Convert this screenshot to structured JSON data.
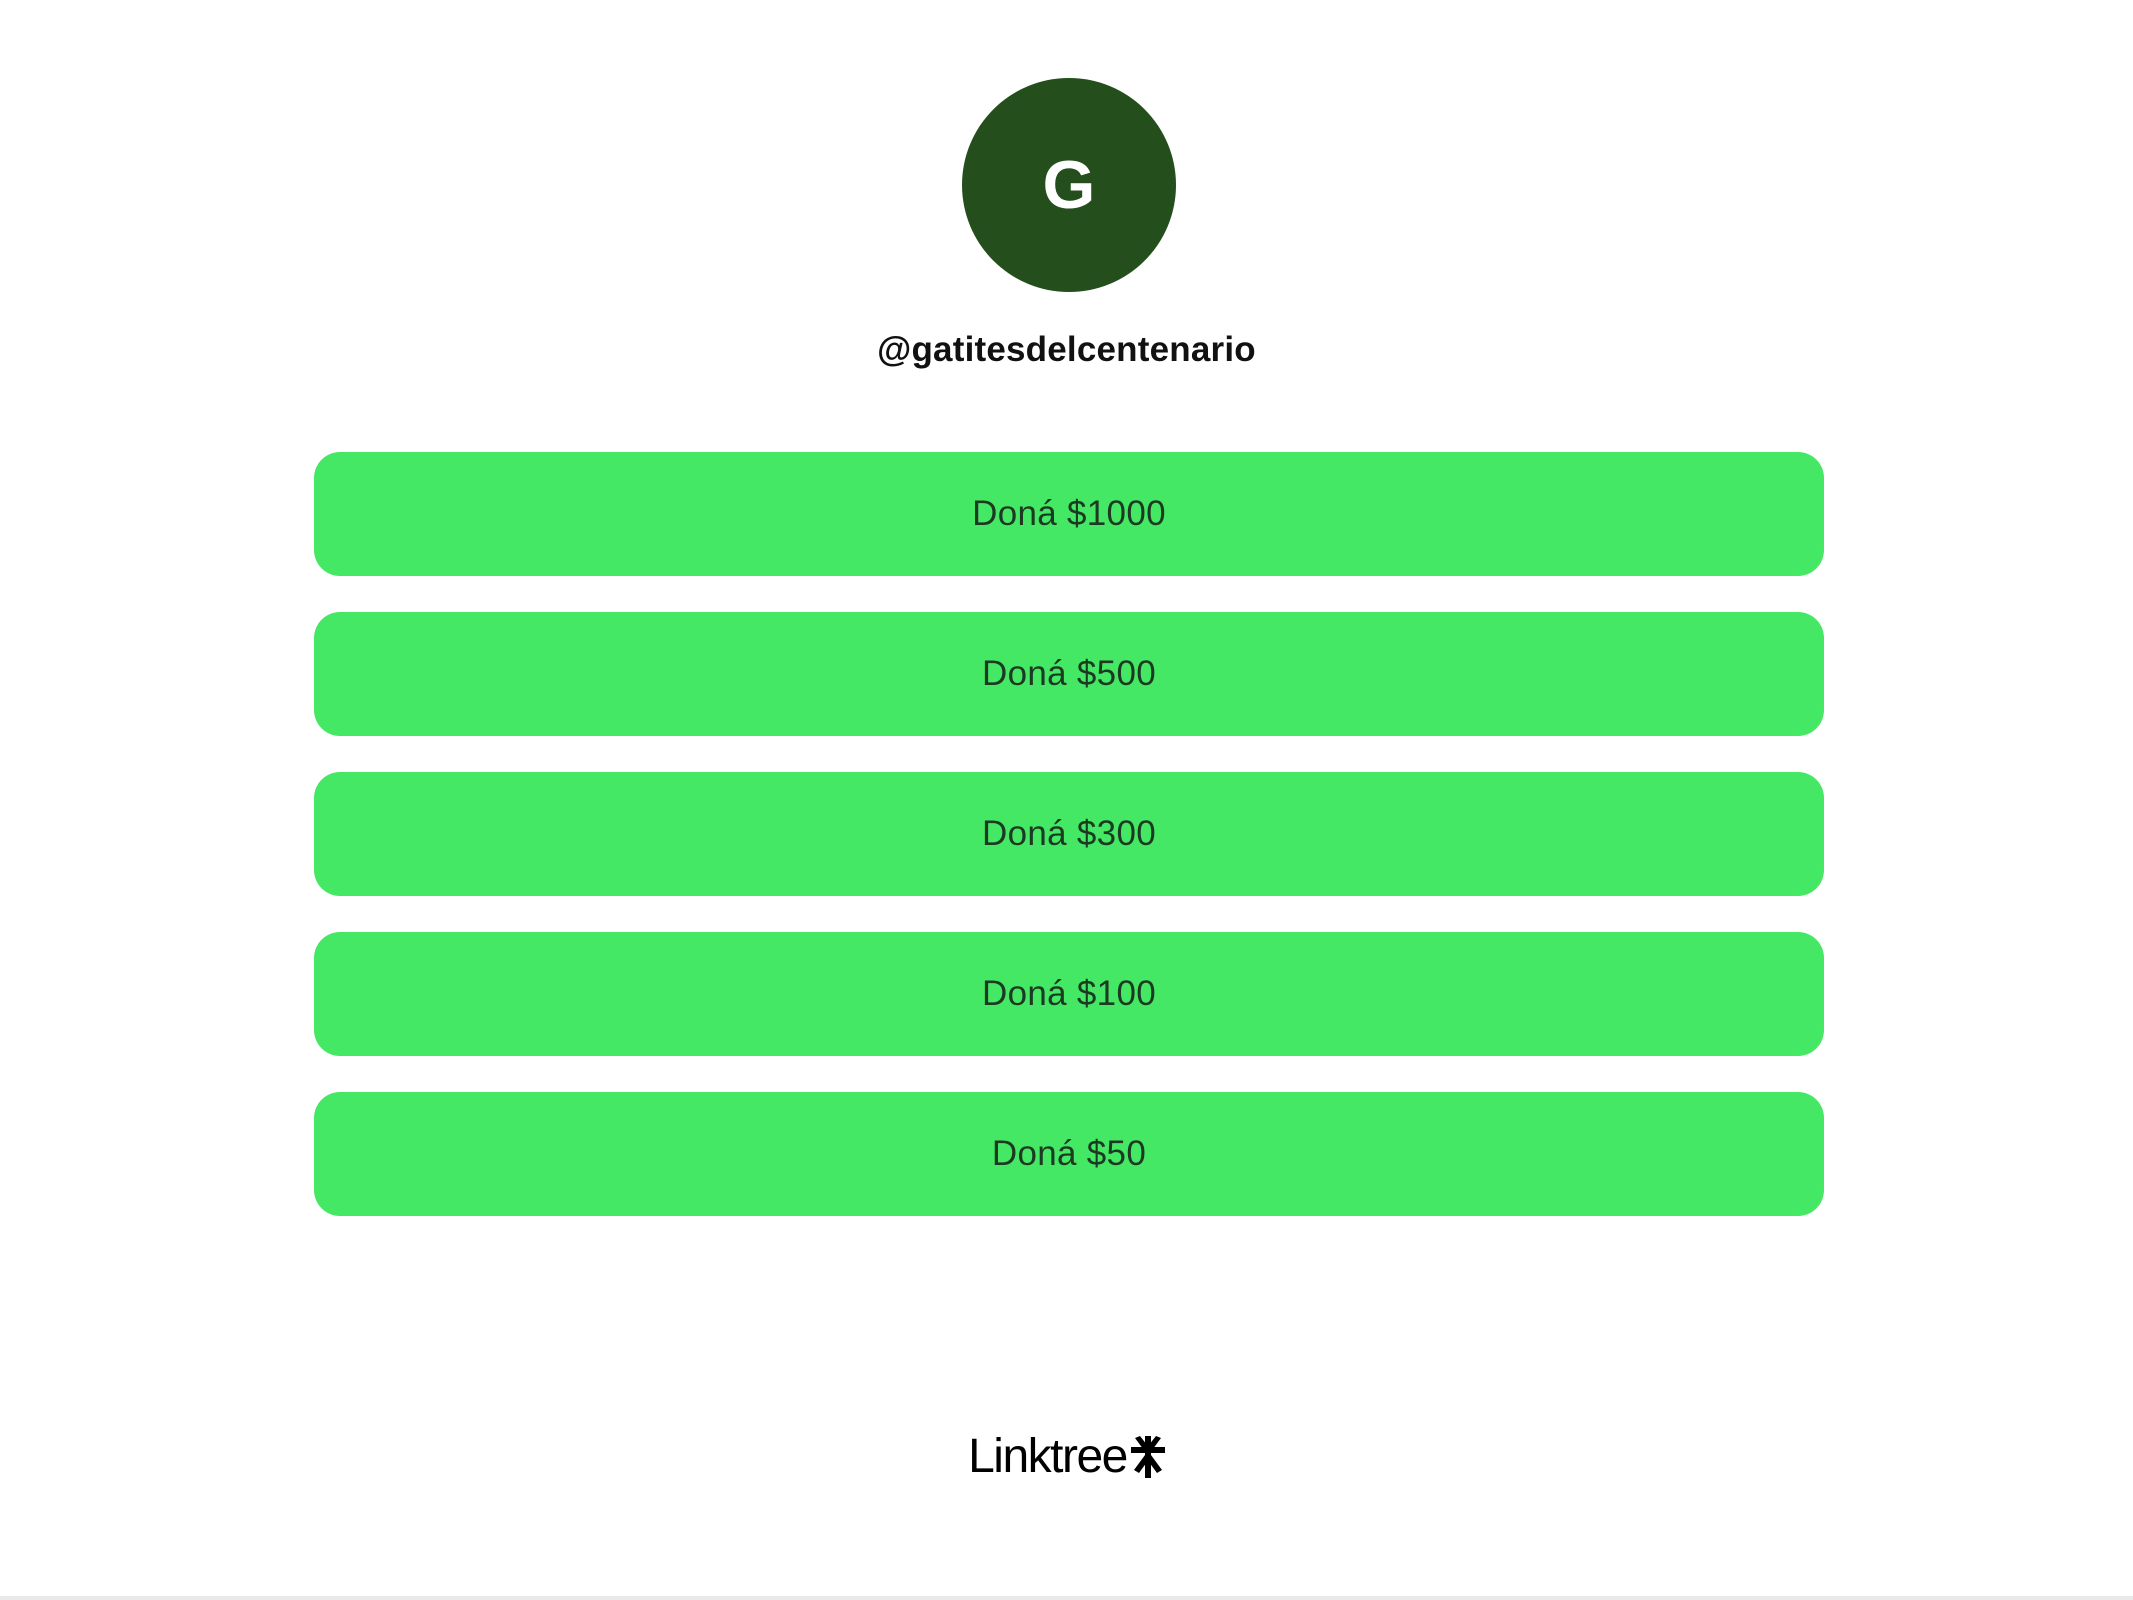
{
  "profile": {
    "avatar_initial": "G",
    "avatar_color": "#244e1c",
    "username": "@gatitesdelcentenario"
  },
  "links": [
    {
      "label": "Doná $1000"
    },
    {
      "label": "Doná $500"
    },
    {
      "label": "Doná $300"
    },
    {
      "label": "Doná $100"
    },
    {
      "label": "Doná $50"
    }
  ],
  "theme": {
    "button_color": "#45e865",
    "button_text_color": "#1c3a22",
    "background": "#ffffff"
  },
  "footer": {
    "brand_text": "Linktree",
    "brand_icon": "linktree-asterisk-icon"
  }
}
